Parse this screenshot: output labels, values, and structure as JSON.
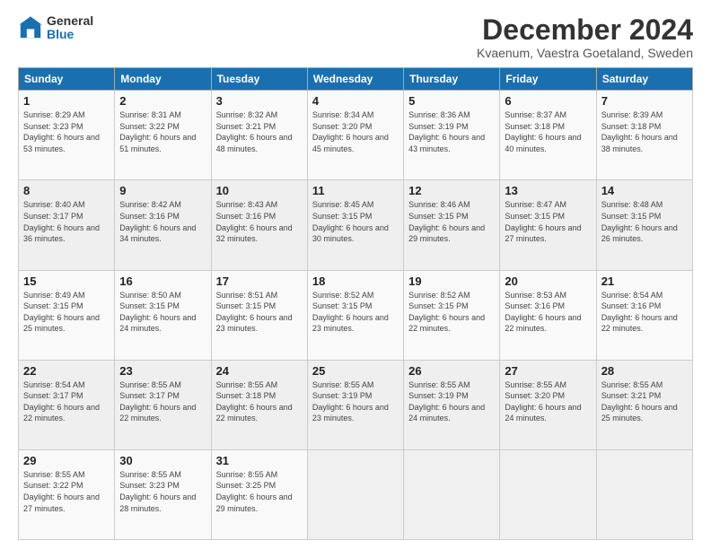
{
  "logo": {
    "general": "General",
    "blue": "Blue"
  },
  "title": "December 2024",
  "subtitle": "Kvaenum, Vaestra Goetaland, Sweden",
  "days_header": [
    "Sunday",
    "Monday",
    "Tuesday",
    "Wednesday",
    "Thursday",
    "Friday",
    "Saturday"
  ],
  "weeks": [
    [
      {
        "day": "1",
        "sunrise": "Sunrise: 8:29 AM",
        "sunset": "Sunset: 3:23 PM",
        "daylight": "Daylight: 6 hours and 53 minutes."
      },
      {
        "day": "2",
        "sunrise": "Sunrise: 8:31 AM",
        "sunset": "Sunset: 3:22 PM",
        "daylight": "Daylight: 6 hours and 51 minutes."
      },
      {
        "day": "3",
        "sunrise": "Sunrise: 8:32 AM",
        "sunset": "Sunset: 3:21 PM",
        "daylight": "Daylight: 6 hours and 48 minutes."
      },
      {
        "day": "4",
        "sunrise": "Sunrise: 8:34 AM",
        "sunset": "Sunset: 3:20 PM",
        "daylight": "Daylight: 6 hours and 45 minutes."
      },
      {
        "day": "5",
        "sunrise": "Sunrise: 8:36 AM",
        "sunset": "Sunset: 3:19 PM",
        "daylight": "Daylight: 6 hours and 43 minutes."
      },
      {
        "day": "6",
        "sunrise": "Sunrise: 8:37 AM",
        "sunset": "Sunset: 3:18 PM",
        "daylight": "Daylight: 6 hours and 40 minutes."
      },
      {
        "day": "7",
        "sunrise": "Sunrise: 8:39 AM",
        "sunset": "Sunset: 3:18 PM",
        "daylight": "Daylight: 6 hours and 38 minutes."
      }
    ],
    [
      {
        "day": "8",
        "sunrise": "Sunrise: 8:40 AM",
        "sunset": "Sunset: 3:17 PM",
        "daylight": "Daylight: 6 hours and 36 minutes."
      },
      {
        "day": "9",
        "sunrise": "Sunrise: 8:42 AM",
        "sunset": "Sunset: 3:16 PM",
        "daylight": "Daylight: 6 hours and 34 minutes."
      },
      {
        "day": "10",
        "sunrise": "Sunrise: 8:43 AM",
        "sunset": "Sunset: 3:16 PM",
        "daylight": "Daylight: 6 hours and 32 minutes."
      },
      {
        "day": "11",
        "sunrise": "Sunrise: 8:45 AM",
        "sunset": "Sunset: 3:15 PM",
        "daylight": "Daylight: 6 hours and 30 minutes."
      },
      {
        "day": "12",
        "sunrise": "Sunrise: 8:46 AM",
        "sunset": "Sunset: 3:15 PM",
        "daylight": "Daylight: 6 hours and 29 minutes."
      },
      {
        "day": "13",
        "sunrise": "Sunrise: 8:47 AM",
        "sunset": "Sunset: 3:15 PM",
        "daylight": "Daylight: 6 hours and 27 minutes."
      },
      {
        "day": "14",
        "sunrise": "Sunrise: 8:48 AM",
        "sunset": "Sunset: 3:15 PM",
        "daylight": "Daylight: 6 hours and 26 minutes."
      }
    ],
    [
      {
        "day": "15",
        "sunrise": "Sunrise: 8:49 AM",
        "sunset": "Sunset: 3:15 PM",
        "daylight": "Daylight: 6 hours and 25 minutes."
      },
      {
        "day": "16",
        "sunrise": "Sunrise: 8:50 AM",
        "sunset": "Sunset: 3:15 PM",
        "daylight": "Daylight: 6 hours and 24 minutes."
      },
      {
        "day": "17",
        "sunrise": "Sunrise: 8:51 AM",
        "sunset": "Sunset: 3:15 PM",
        "daylight": "Daylight: 6 hours and 23 minutes."
      },
      {
        "day": "18",
        "sunrise": "Sunrise: 8:52 AM",
        "sunset": "Sunset: 3:15 PM",
        "daylight": "Daylight: 6 hours and 23 minutes."
      },
      {
        "day": "19",
        "sunrise": "Sunrise: 8:52 AM",
        "sunset": "Sunset: 3:15 PM",
        "daylight": "Daylight: 6 hours and 22 minutes."
      },
      {
        "day": "20",
        "sunrise": "Sunrise: 8:53 AM",
        "sunset": "Sunset: 3:16 PM",
        "daylight": "Daylight: 6 hours and 22 minutes."
      },
      {
        "day": "21",
        "sunrise": "Sunrise: 8:54 AM",
        "sunset": "Sunset: 3:16 PM",
        "daylight": "Daylight: 6 hours and 22 minutes."
      }
    ],
    [
      {
        "day": "22",
        "sunrise": "Sunrise: 8:54 AM",
        "sunset": "Sunset: 3:17 PM",
        "daylight": "Daylight: 6 hours and 22 minutes."
      },
      {
        "day": "23",
        "sunrise": "Sunrise: 8:55 AM",
        "sunset": "Sunset: 3:17 PM",
        "daylight": "Daylight: 6 hours and 22 minutes."
      },
      {
        "day": "24",
        "sunrise": "Sunrise: 8:55 AM",
        "sunset": "Sunset: 3:18 PM",
        "daylight": "Daylight: 6 hours and 22 minutes."
      },
      {
        "day": "25",
        "sunrise": "Sunrise: 8:55 AM",
        "sunset": "Sunset: 3:19 PM",
        "daylight": "Daylight: 6 hours and 23 minutes."
      },
      {
        "day": "26",
        "sunrise": "Sunrise: 8:55 AM",
        "sunset": "Sunset: 3:19 PM",
        "daylight": "Daylight: 6 hours and 24 minutes."
      },
      {
        "day": "27",
        "sunrise": "Sunrise: 8:55 AM",
        "sunset": "Sunset: 3:20 PM",
        "daylight": "Daylight: 6 hours and 24 minutes."
      },
      {
        "day": "28",
        "sunrise": "Sunrise: 8:55 AM",
        "sunset": "Sunset: 3:21 PM",
        "daylight": "Daylight: 6 hours and 25 minutes."
      }
    ],
    [
      {
        "day": "29",
        "sunrise": "Sunrise: 8:55 AM",
        "sunset": "Sunset: 3:22 PM",
        "daylight": "Daylight: 6 hours and 27 minutes."
      },
      {
        "day": "30",
        "sunrise": "Sunrise: 8:55 AM",
        "sunset": "Sunset: 3:23 PM",
        "daylight": "Daylight: 6 hours and 28 minutes."
      },
      {
        "day": "31",
        "sunrise": "Sunrise: 8:55 AM",
        "sunset": "Sunset: 3:25 PM",
        "daylight": "Daylight: 6 hours and 29 minutes."
      },
      null,
      null,
      null,
      null
    ]
  ]
}
